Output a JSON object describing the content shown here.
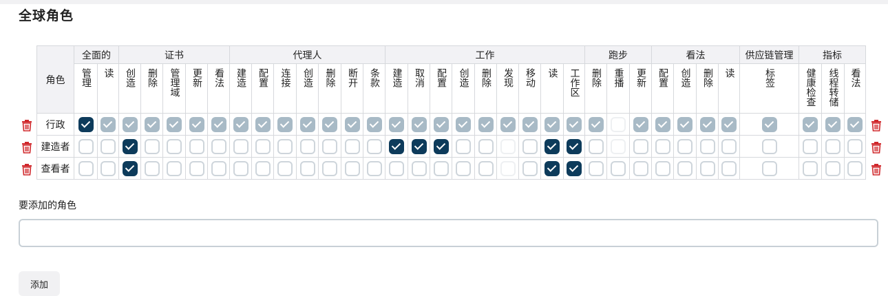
{
  "page_title": "全球角色",
  "colors": {
    "checked": "#0d3b5b",
    "locked": "#a8bac6",
    "trash": "#d0282c"
  },
  "table": {
    "role_header": "角色",
    "groups": [
      {
        "label": "全面的",
        "perms": [
          "管理",
          "读"
        ]
      },
      {
        "label": "证书",
        "perms": [
          "创造",
          "删除",
          "管理域",
          "更新",
          "看法"
        ]
      },
      {
        "label": "代理人",
        "perms": [
          "建造",
          "配置",
          "连接",
          "创造",
          "删除",
          "断开",
          "条款"
        ]
      },
      {
        "label": "工作",
        "perms": [
          "建造",
          "取消",
          "配置",
          "创造",
          "删除",
          "发现",
          "移动",
          "读",
          "工作区"
        ]
      },
      {
        "label": "跑步",
        "perms": [
          "删除",
          "重播",
          "更新"
        ]
      },
      {
        "label": "看法",
        "perms": [
          "配置",
          "创造",
          "删除",
          "读"
        ]
      },
      {
        "label": "供应链管理",
        "perms": [
          "标签"
        ]
      },
      {
        "label": "指标",
        "perms": [
          "健康检查",
          "线程转储",
          "看法"
        ]
      }
    ],
    "rows": [
      {
        "name": "行政",
        "states": [
          "checked",
          "locked",
          "locked",
          "locked",
          "locked",
          "locked",
          "locked",
          "locked",
          "locked",
          "locked",
          "locked",
          "locked",
          "locked",
          "locked",
          "locked",
          "locked",
          "locked",
          "locked",
          "locked",
          "locked",
          "locked",
          "locked",
          "locked",
          "locked",
          "faint",
          "locked",
          "locked",
          "locked",
          "locked",
          "locked",
          "locked",
          "locked",
          "locked",
          "locked"
        ]
      },
      {
        "name": "建造者",
        "states": [
          "empty",
          "empty",
          "checked",
          "empty",
          "empty",
          "empty",
          "empty",
          "empty",
          "empty",
          "empty",
          "empty",
          "empty",
          "empty",
          "empty",
          "checked",
          "checked",
          "checked",
          "empty",
          "empty",
          "faint",
          "empty",
          "checked",
          "checked",
          "empty",
          "faint",
          "empty",
          "empty",
          "empty",
          "empty",
          "empty",
          "empty",
          "empty",
          "empty",
          "empty"
        ]
      },
      {
        "name": "查看者",
        "states": [
          "empty",
          "empty",
          "checked",
          "empty",
          "empty",
          "empty",
          "empty",
          "empty",
          "empty",
          "empty",
          "empty",
          "empty",
          "empty",
          "empty",
          "empty",
          "empty",
          "empty",
          "empty",
          "empty",
          "faint",
          "empty",
          "checked",
          "checked",
          "empty",
          "empty",
          "empty",
          "empty",
          "empty",
          "empty",
          "empty",
          "empty",
          "empty",
          "empty",
          "empty"
        ]
      }
    ]
  },
  "add_role": {
    "label": "要添加的角色",
    "input_value": "",
    "placeholder": "",
    "button_label": "添加"
  }
}
